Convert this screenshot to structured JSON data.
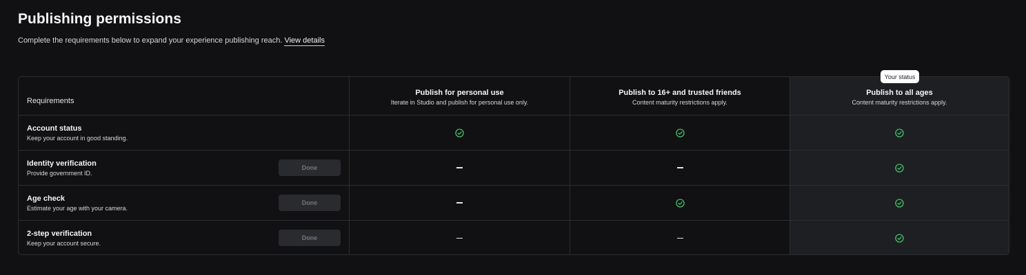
{
  "header": {
    "title": "Publishing permissions",
    "subtitle": "Complete the requirements below to expand your experience publishing reach.",
    "link": "View details"
  },
  "status_badge": "Your status",
  "table": {
    "requirements_header": "Requirements",
    "columns": [
      {
        "title": "Publish for personal use",
        "desc": "Iterate in Studio and publish for personal use only."
      },
      {
        "title": "Publish to 16+ and trusted friends",
        "desc": "Content maturity restrictions apply."
      },
      {
        "title": "Publish to all ages",
        "desc": "Content maturity restrictions apply."
      }
    ],
    "rows": [
      {
        "name": "Account status",
        "desc": "Keep your account in good standing.",
        "button": "",
        "cells": [
          "check",
          "check",
          "check"
        ]
      },
      {
        "name": "Identity verification",
        "desc": "Provide government ID.",
        "button": "Done",
        "cells": [
          "dash",
          "dash",
          "check"
        ]
      },
      {
        "name": "Age check",
        "desc": "Estimate your age with your camera.",
        "button": "Done",
        "cells": [
          "dash",
          "check",
          "check"
        ]
      },
      {
        "name": "2-step verification",
        "desc": "Keep your account secure.",
        "button": "Done",
        "cells": [
          "dash",
          "dash",
          "check"
        ]
      }
    ]
  },
  "colors": {
    "background": "#111113",
    "check": "#3ecf6e",
    "highlight_column": "#1e1f23"
  },
  "icons": {
    "check": "check-circle-icon",
    "dash": "dash-icon"
  }
}
